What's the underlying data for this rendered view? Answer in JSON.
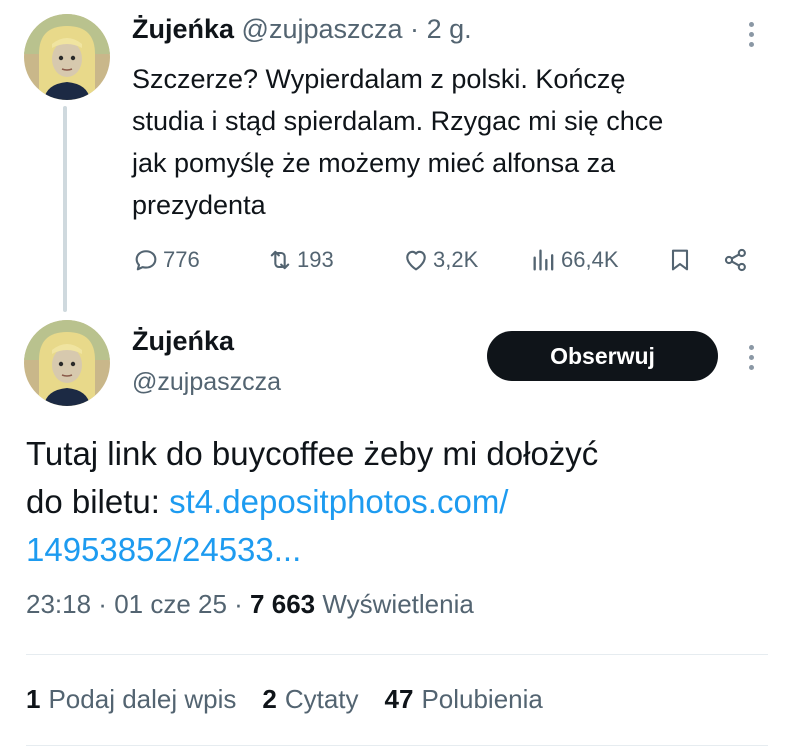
{
  "reply": {
    "author_name": "Żujeńka",
    "author_handle": "@zujpaszcza",
    "separator": "·",
    "time": "2 g.",
    "text_lines": [
      "Szczerze? Wypierdalam z polski. Kończę",
      "studia i stąd spierdalam. Rzygac mi się chce",
      "jak pomyślę że możemy mieć alfonsa za",
      "prezydenta"
    ],
    "actions": {
      "replies": "776",
      "reposts": "193",
      "likes": "3,2K",
      "views": "66,4K"
    },
    "icons": [
      "reply-icon",
      "repost-icon",
      "like-icon",
      "views-icon",
      "bookmark-icon",
      "share-icon",
      "more-icon"
    ]
  },
  "main": {
    "author_name": "Żujeńka",
    "author_handle": "@zujpaszcza",
    "follow_label": "Obserwuj",
    "text_line1": "Tutaj link do buycoffee żeby mi dołożyć",
    "text_line2_prefix": "do biletu: ",
    "link_line1": "st4.depositphotos.com/",
    "link_line2": "14953852/24533...",
    "meta": {
      "time": "23:18",
      "sep1": " · ",
      "date": "01 cze 25",
      "sep2": " · ",
      "views_count": "7 663",
      "views_label": " Wyświetlenia"
    },
    "stats": [
      {
        "count": "1",
        "label": "Podaj dalej wpis"
      },
      {
        "count": "2",
        "label": "Cytaty"
      },
      {
        "count": "47",
        "label": "Polubienia"
      }
    ]
  },
  "colors": {
    "text": "#0f1419",
    "secondary": "#536471",
    "link": "#1d9bf0",
    "button": "#0f1419",
    "divider": "#e6ecf0"
  }
}
